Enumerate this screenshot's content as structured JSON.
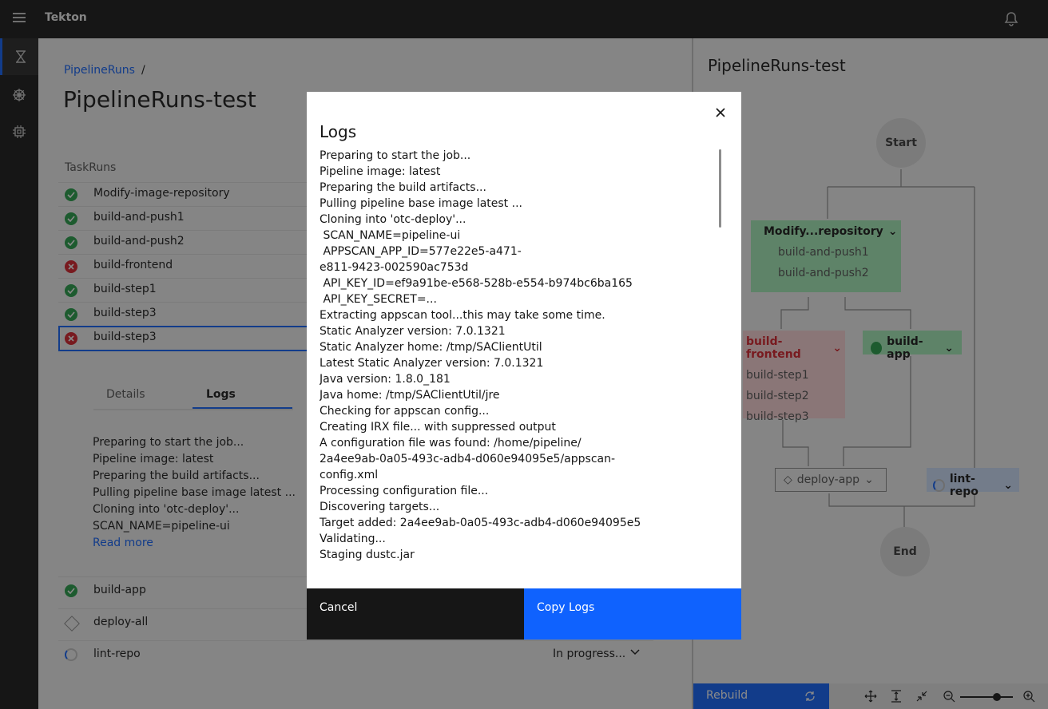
{
  "header": {
    "app_title": "Tekton"
  },
  "breadcrumb": {
    "link": "PipelineRuns",
    "separator": "/"
  },
  "page_title": "PipelineRuns-test",
  "taskruns": {
    "header": "TaskRuns",
    "items": [
      {
        "label": "Modify-image-repository",
        "status": "success"
      },
      {
        "label": "build-and-push1",
        "status": "success"
      },
      {
        "label": "build-and-push2",
        "status": "success"
      },
      {
        "label": "build-frontend",
        "status": "error"
      },
      {
        "label": "build-step1",
        "status": "success"
      },
      {
        "label": "build-step3",
        "status": "success"
      },
      {
        "label": "build-step3",
        "status": "error"
      }
    ],
    "more": [
      {
        "label": "build-app",
        "status": "success"
      },
      {
        "label": "deploy-all",
        "status": "pending"
      },
      {
        "label": "lint-repo",
        "status": "running",
        "status_text": "In progress..."
      }
    ]
  },
  "details": {
    "tabs": [
      "Details",
      "Logs"
    ],
    "preview": [
      "Preparing to start the job...",
      "Pipeline image: latest",
      "Preparing the build artifacts...",
      "Pulling pipeline base image latest ...",
      "Cloning into 'otc-deploy'...",
      "SCAN_NAME=pipeline-ui"
    ],
    "read_more": "Read more"
  },
  "graph": {
    "title": "PipelineRuns-test",
    "start": "Start",
    "end": "End",
    "group1": {
      "label": "Modify...repository",
      "children": [
        "build-and-push1",
        "build-and-push2"
      ]
    },
    "group2": {
      "label": "build-frontend",
      "children": [
        "build-step1",
        "build-step2",
        "build-step3"
      ]
    },
    "group3": {
      "label": "build-app"
    },
    "group4": {
      "label": "deploy-app"
    },
    "group5": {
      "label": "lint-repo"
    },
    "rebuild": "Rebuild"
  },
  "modal": {
    "title": "Logs",
    "lines": [
      "Preparing to start the job...",
      "Pipeline image: latest",
      "Preparing the build artifacts...",
      "Pulling pipeline base image latest ...",
      "Cloning into 'otc-deploy'...",
      " SCAN_NAME=pipeline-ui",
      " APPSCAN_APP_ID=577e22e5-a471-",
      "e811-9423-002590ac753d",
      " API_KEY_ID=ef9a91be-e568-528b-e554-b974bc6ba165",
      " API_KEY_SECRET=...",
      "Extracting appscan tool...this may take some time.",
      "Static Analyzer version: 7.0.1321",
      "Static Analyzer home: /tmp/SAClientUtil",
      "Latest Static Analyzer version: 7.0.1321",
      "Java version: 1.8.0_181",
      "Java home: /tmp/SAClientUtil/jre",
      "Checking for appscan config...",
      "Creating IRX file... with suppressed output",
      "A configuration file was found: /home/pipeline/",
      "2a4ee9ab-0a05-493c-adb4-d060e94095e5/appscan-",
      "config.xml",
      "Processing configuration file...",
      "Discovering targets...",
      "Target added: 2a4ee9ab-0a05-493c-adb4-d060e94095e5",
      "Validating...",
      "Staging dustc.jar"
    ],
    "cancel": "Cancel",
    "copy": "Copy Logs"
  }
}
